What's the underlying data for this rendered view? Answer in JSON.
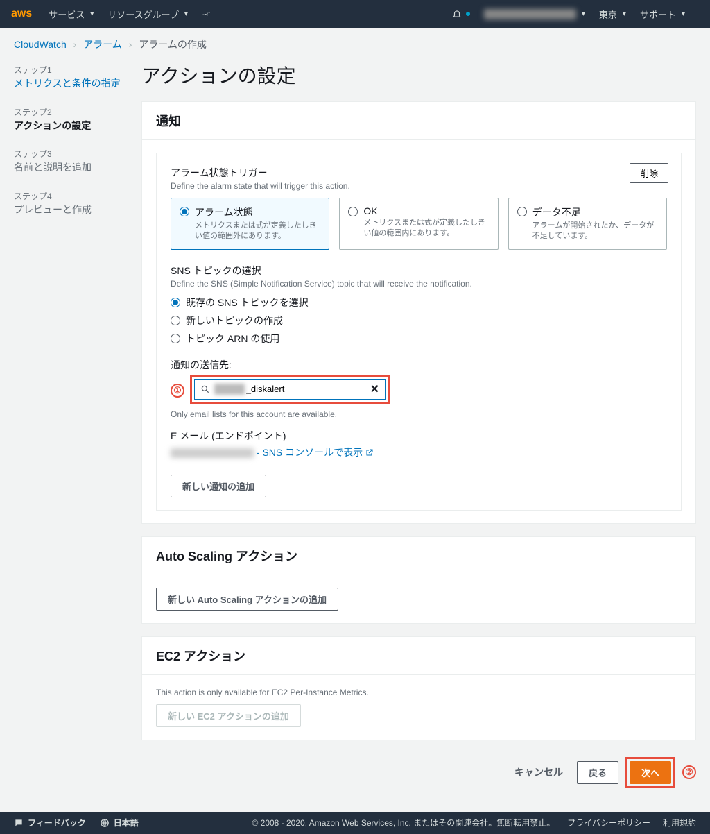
{
  "topnav": {
    "logo": "aws",
    "services": "サービス",
    "resource_groups": "リソースグループ",
    "account_blur": "████████████ ...",
    "region": "東京",
    "support": "サポート"
  },
  "breadcrumb": {
    "cloudwatch": "CloudWatch",
    "alarms": "アラーム",
    "create": "アラームの作成"
  },
  "steps": {
    "s1_label": "ステップ1",
    "s1_title": "メトリクスと条件の指定",
    "s2_label": "ステップ2",
    "s2_title": "アクションの設定",
    "s3_label": "ステップ3",
    "s3_title": "名前と説明を追加",
    "s4_label": "ステップ4",
    "s4_title": "プレビューと作成"
  },
  "page": {
    "title": "アクションの設定"
  },
  "notification": {
    "header": "通知",
    "delete_btn": "削除",
    "trigger_title": "アラーム状態トリガー",
    "trigger_desc": "Define the alarm state that will trigger this action.",
    "triggers": [
      {
        "label": "アラーム状態",
        "desc": "メトリクスまたは式が定義したしきい値の範囲外にあります。"
      },
      {
        "label": "OK",
        "desc": "メトリクスまたは式が定義したしきい値の範囲内にあります。"
      },
      {
        "label": "データ不足",
        "desc": "アラームが開始されたか、データが不足しています。"
      }
    ],
    "sns_title": "SNS トピックの選択",
    "sns_desc": "Define the SNS (Simple Notification Service) topic that will receive the notification.",
    "sns_opts": {
      "existing": "既存の SNS トピックを選択",
      "new": "新しいトピックの作成",
      "arn": "トピック ARN の使用"
    },
    "send_to_label": "通知の送信先:",
    "search_value_suffix": "_diskalert",
    "search_note": "Only email lists for this account are available.",
    "email_label": "E メール (エンドポイント)",
    "sns_console_link": " - SNS コンソールで表示",
    "add_notification_btn": "新しい通知の追加"
  },
  "autoscaling": {
    "header": "Auto Scaling アクション",
    "add_btn": "新しい Auto Scaling アクションの追加"
  },
  "ec2": {
    "header": "EC2 アクション",
    "note": "This action is only available for EC2 Per-Instance Metrics.",
    "add_btn": "新しい EC2 アクションの追加"
  },
  "wizard": {
    "cancel": "キャンセル",
    "back": "戻る",
    "next": "次へ"
  },
  "annotations": {
    "a1": "①",
    "a2": "②"
  },
  "footer": {
    "feedback": "フィードバック",
    "language": "日本語",
    "copyright": "© 2008 - 2020, Amazon Web Services, Inc. またはその関連会社。無断転用禁止。",
    "privacy": "プライバシーポリシー",
    "terms": "利用規約"
  }
}
